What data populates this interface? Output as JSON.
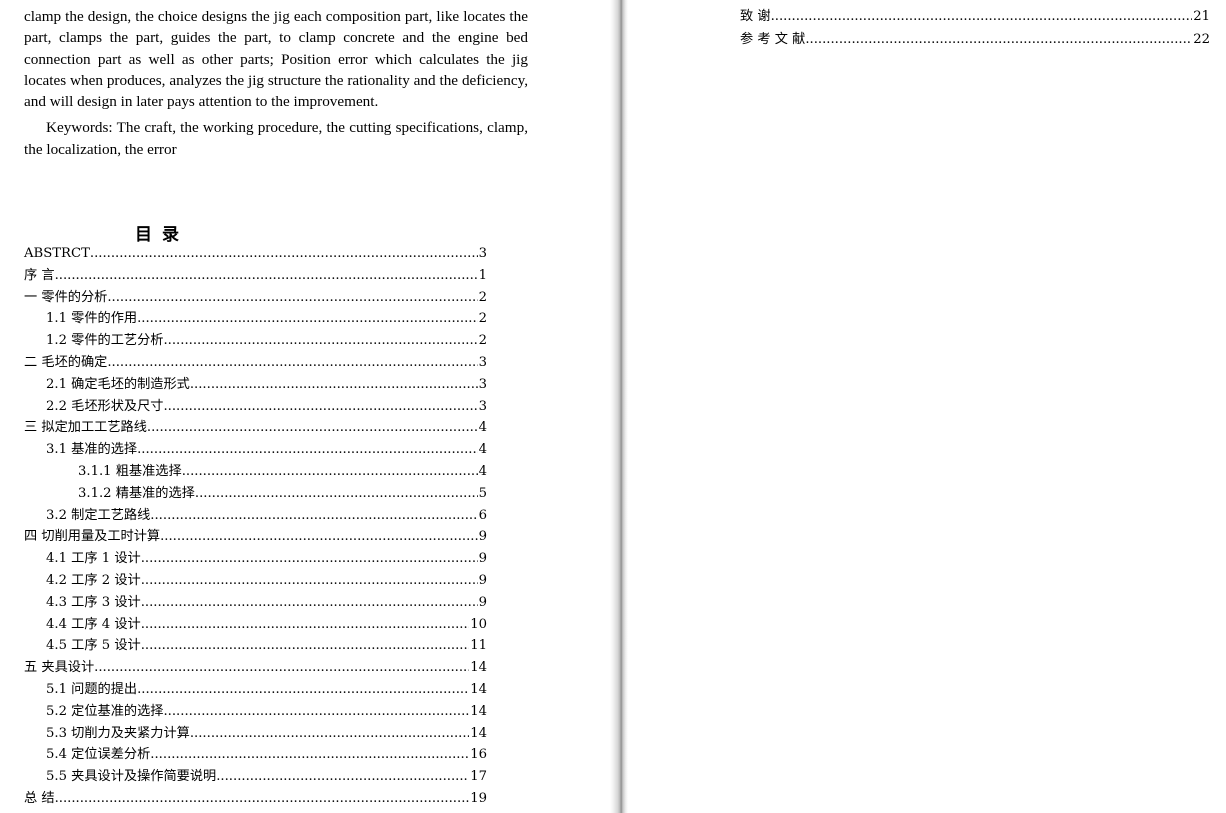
{
  "document": {
    "abstract_paragraph": "clamp the design, the choice designs the jig each composition part, like locates the part, clamps the part, guides the part, to clamp concrete and the engine bed connection part as well as other parts; Position error which calculates the jig locates when produces, analyzes the jig structure the rationality and the deficiency, and will design in later pays attention to the improvement.",
    "keywords_paragraph": "Keywords: The craft, the working procedure, the cutting specifications, clamp, the localization, the error",
    "toc_title": "目 录",
    "toc_left": [
      {
        "label": "ABSTRCT",
        "page": "3",
        "indent": 0
      },
      {
        "label": "序 言",
        "page": "1",
        "indent": 0
      },
      {
        "label": "一 零件的分析",
        "page": "2",
        "indent": 0
      },
      {
        "label": "1.1 零件的作用",
        "page": "2",
        "indent": 1
      },
      {
        "label": "1.2 零件的工艺分析",
        "page": "2",
        "indent": 1
      },
      {
        "label": "二 毛坯的确定",
        "page": "3",
        "indent": 0
      },
      {
        "label": "2.1 确定毛坯的制造形式",
        "page": "3",
        "indent": 1
      },
      {
        "label": "2.2 毛坯形状及尺寸",
        "page": "3",
        "indent": 1
      },
      {
        "label": "三 拟定加工工艺路线",
        "page": "4",
        "indent": 0
      },
      {
        "label": "3.1 基准的选择",
        "page": "4",
        "indent": 1
      },
      {
        "label": "3.1.1 粗基准选择",
        "page": "4",
        "indent": 2
      },
      {
        "label": "3.1.2 精基准的选择",
        "page": "5",
        "indent": 2
      },
      {
        "label": "3.2 制定工艺路线",
        "page": "6",
        "indent": 1
      },
      {
        "label": "四 切削用量及工时计算",
        "page": "9",
        "indent": 0
      },
      {
        "label": "4.1 工序 1 设计",
        "page": "9",
        "indent": 1
      },
      {
        "label": "4.2 工序 2 设计",
        "page": "9",
        "indent": 1
      },
      {
        "label": "4.3 工序 3 设计",
        "page": "9",
        "indent": 1
      },
      {
        "label": "4.4 工序 4 设计",
        "page": "10",
        "indent": 1
      },
      {
        "label": "4.5 工序 5 设计",
        "page": "11",
        "indent": 1
      },
      {
        "label": "五 夹具设计",
        "page": "14",
        "indent": 0
      },
      {
        "label": "5.1 问题的提出",
        "page": "14",
        "indent": 1
      },
      {
        "label": "5.2 定位基准的选择",
        "page": "14",
        "indent": 1
      },
      {
        "label": "5.3 切削力及夹紧力计算",
        "page": "14",
        "indent": 1
      },
      {
        "label": "5.4 定位误差分析",
        "page": "16",
        "indent": 1
      },
      {
        "label": "5.5 夹具设计及操作简要说明",
        "page": "17",
        "indent": 1
      },
      {
        "label": "总 结",
        "page": "19",
        "indent": 0
      }
    ],
    "toc_right": [
      {
        "label": "致 谢",
        "page": "21",
        "indent": 0
      },
      {
        "label": "参 考 文 献",
        "page": "22",
        "indent": 0
      }
    ]
  }
}
